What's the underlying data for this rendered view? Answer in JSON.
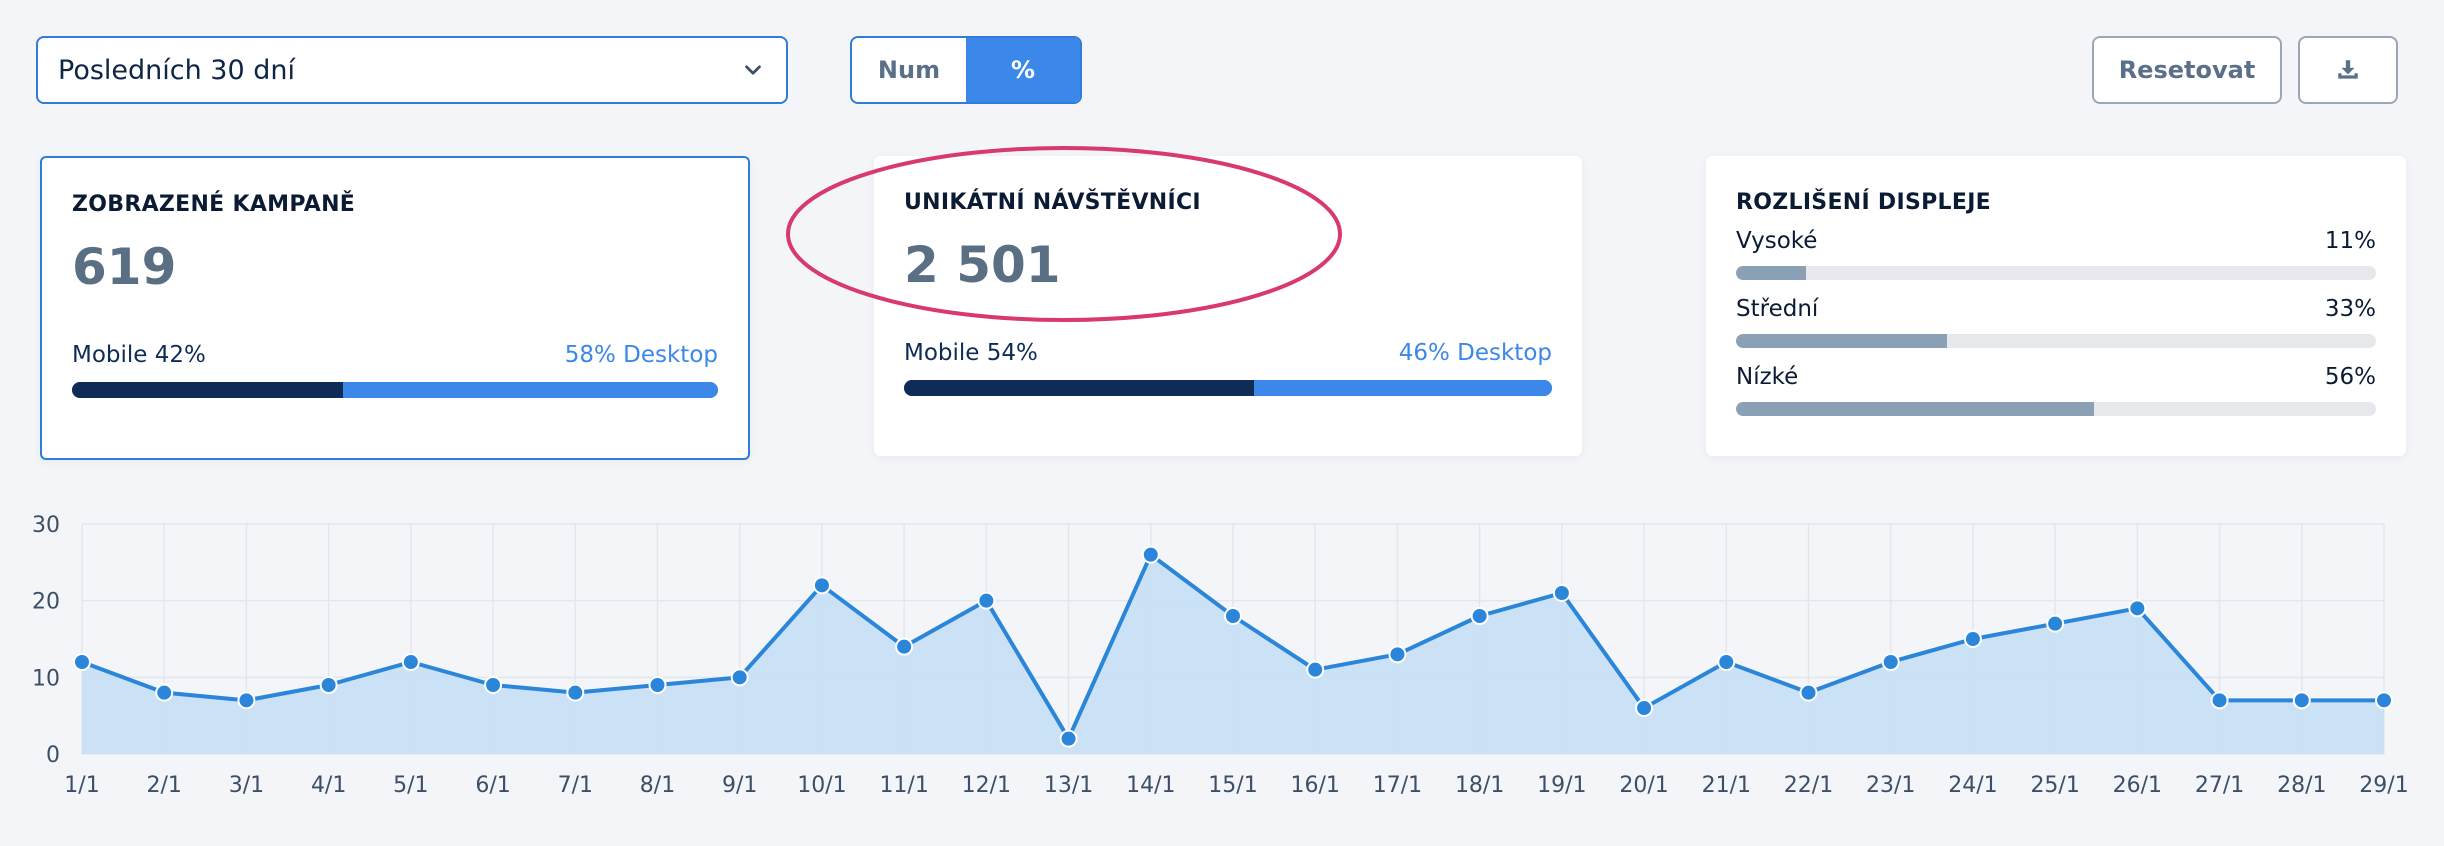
{
  "toolbar": {
    "period_value": "Posledních 30 dní",
    "toggle": {
      "num_label": "Num",
      "pct_label": "%",
      "active": "pct"
    },
    "reset_label": "Resetovat"
  },
  "cards": {
    "campaigns": {
      "title": "ZOBRAZENÉ KAMPANĚ",
      "value": "619",
      "mobile_label": "Mobile 42%",
      "desktop_label": "58% Desktop",
      "mobile_pct": 42
    },
    "visitors": {
      "title": "UNIKÁTNÍ NÁVŠTĚVNÍCI",
      "value": "2 501",
      "mobile_label": "Mobile 54%",
      "desktop_label": "46% Desktop",
      "mobile_pct": 54
    },
    "resolution": {
      "title": "ROZLIŠENÍ DISPLEJE",
      "rows": [
        {
          "label": "Vysoké",
          "value_label": "11%",
          "pct": 11
        },
        {
          "label": "Střední",
          "value_label": "33%",
          "pct": 33
        },
        {
          "label": "Nízké",
          "value_label": "56%",
          "pct": 56
        }
      ]
    }
  },
  "colors": {
    "accent": "#3b87ea",
    "mobile": "#0f2c57",
    "annotation": "#d8396e",
    "line": "#2b86d9",
    "area": "#c8dff5"
  },
  "chart_data": {
    "type": "area",
    "categories": [
      "1/1",
      "2/1",
      "3/1",
      "4/1",
      "5/1",
      "6/1",
      "7/1",
      "8/1",
      "9/1",
      "10/1",
      "11/1",
      "12/1",
      "13/1",
      "14/1",
      "15/1",
      "16/1",
      "17/1",
      "18/1",
      "19/1",
      "20/1",
      "21/1",
      "22/1",
      "23/1",
      "24/1",
      "25/1",
      "26/1",
      "27/1",
      "28/1",
      "29/1"
    ],
    "values": [
      12,
      8,
      7,
      9,
      12,
      9,
      8,
      9,
      10,
      22,
      14,
      20,
      2,
      26,
      18,
      11,
      13,
      18,
      21,
      6,
      12,
      8,
      12,
      15,
      17,
      19,
      7,
      7,
      7
    ],
    "yticks": [
      0,
      10,
      20,
      30
    ],
    "ylim": [
      0,
      30
    ],
    "grid": true,
    "legend": "none"
  }
}
